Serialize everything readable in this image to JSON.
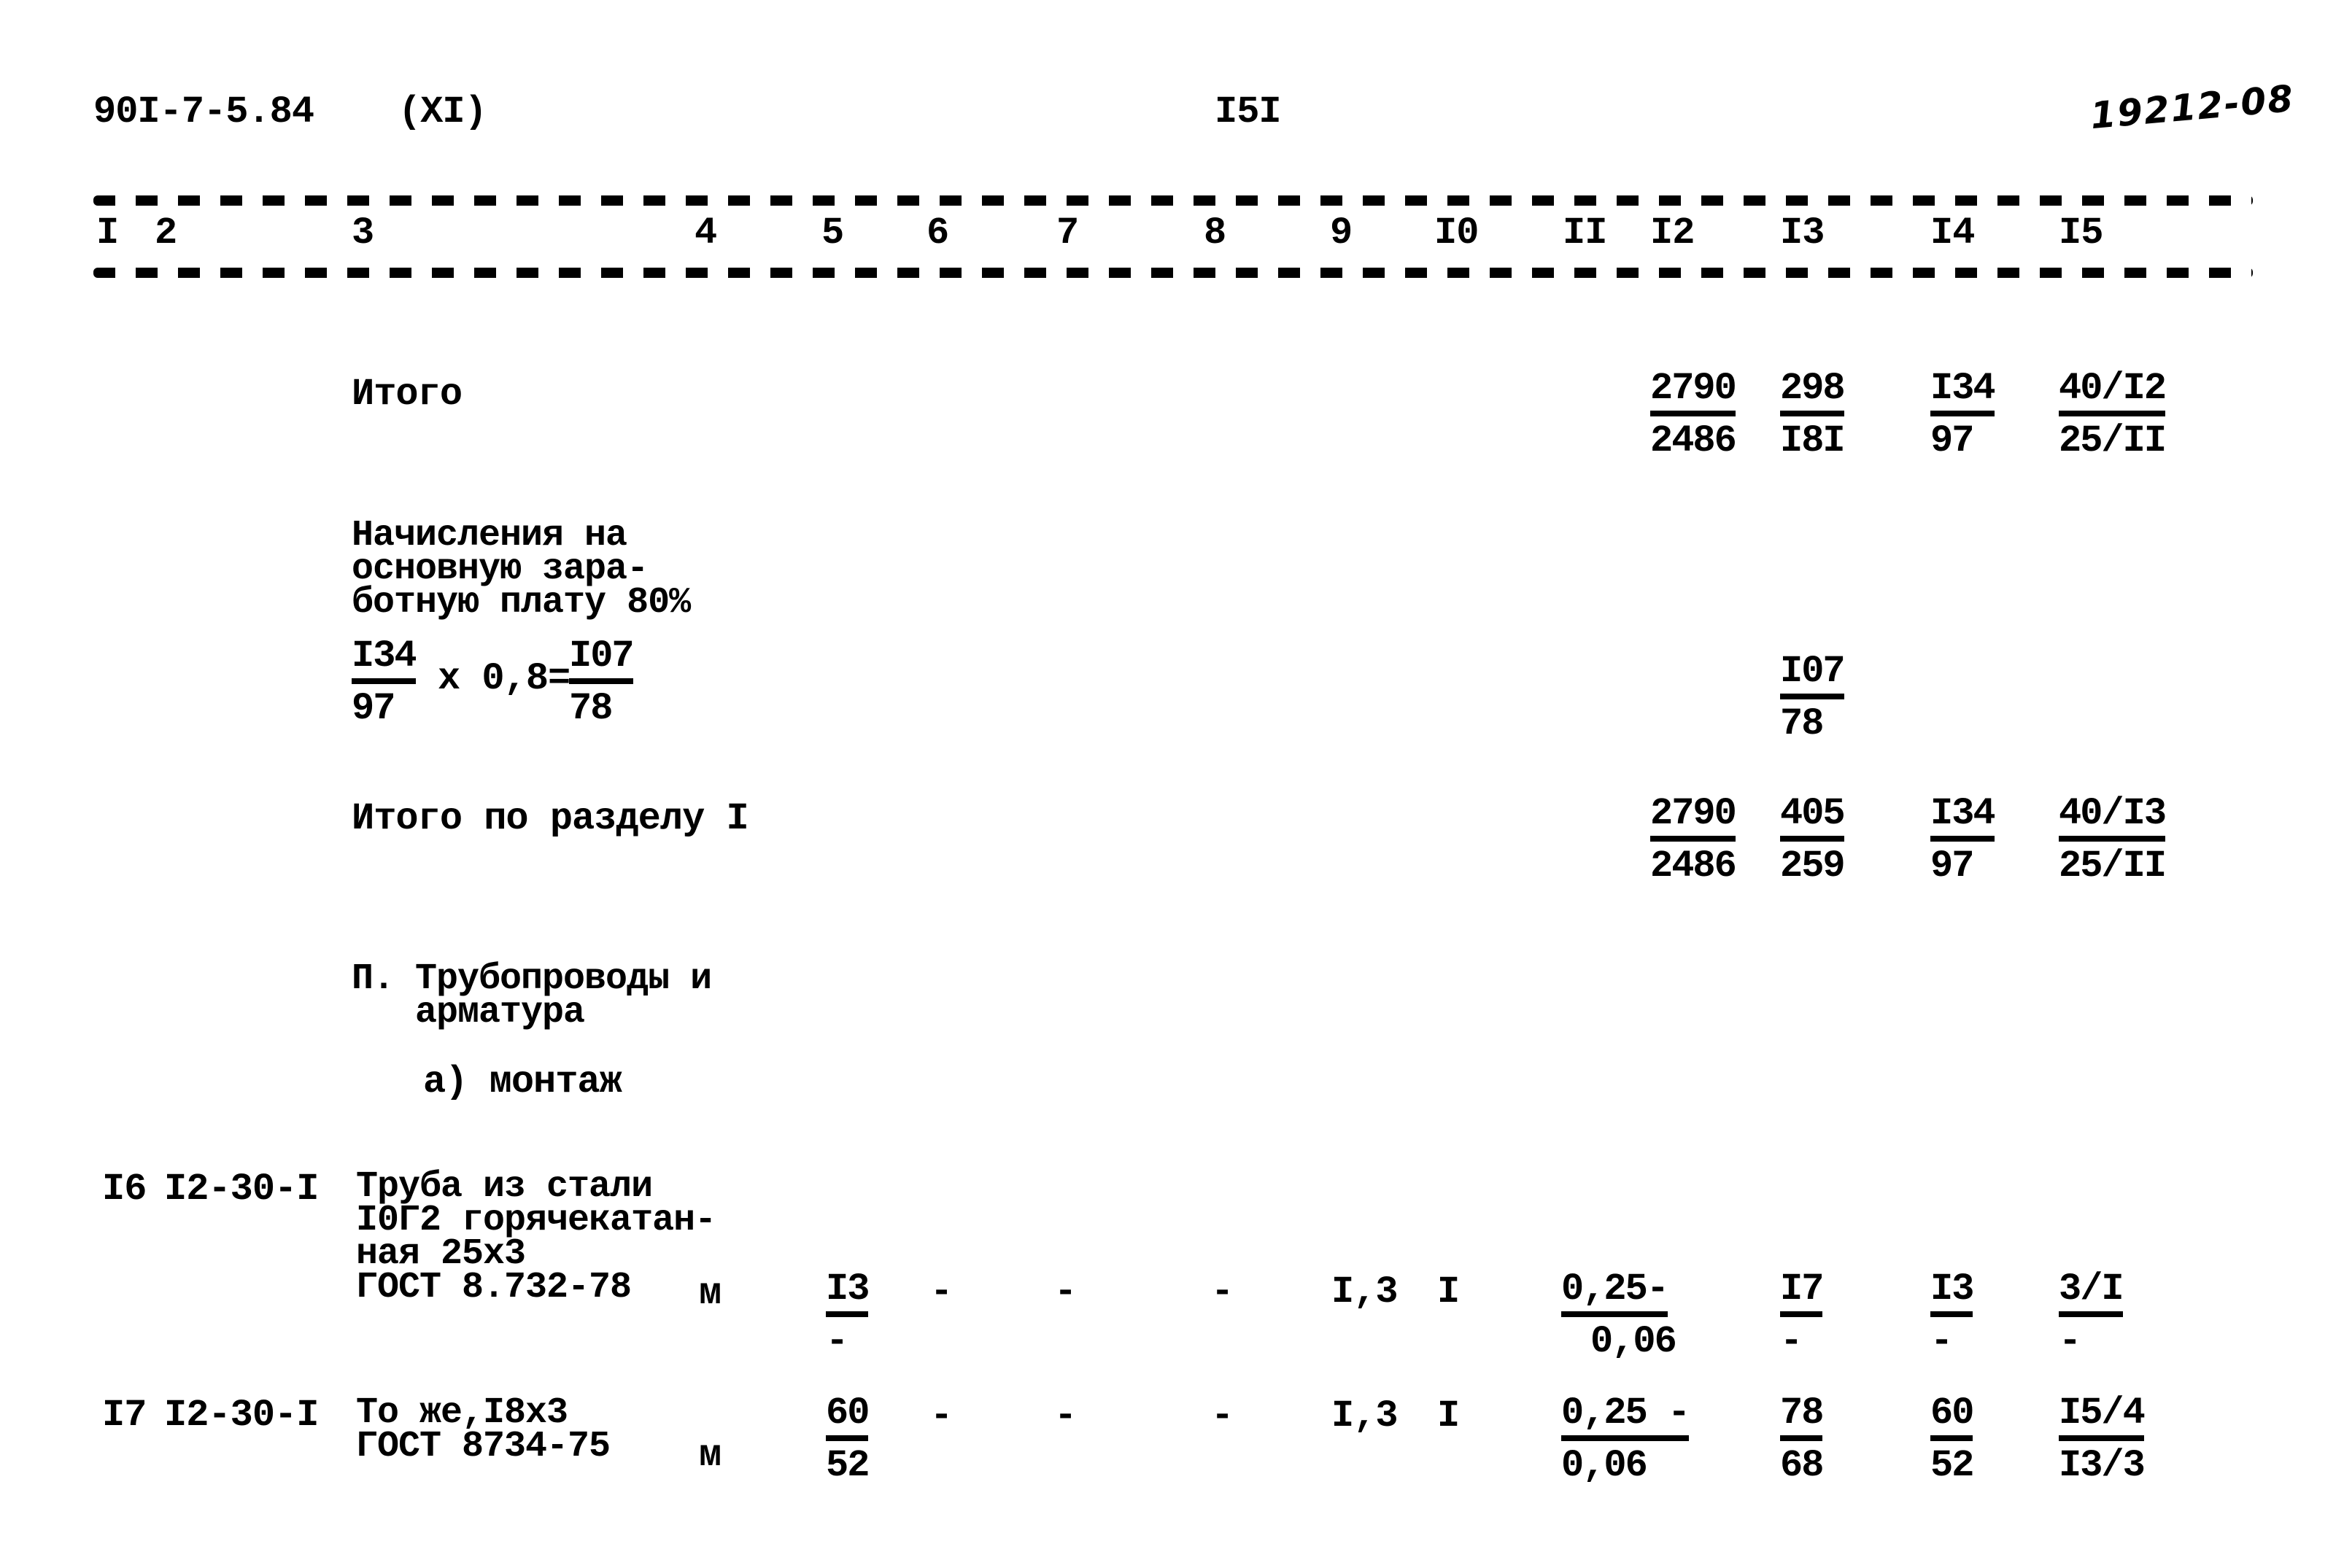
{
  "header": {
    "doc_code": "90I-7-5.84",
    "part": "(XI)",
    "page_number": "I5I",
    "handwritten_ref": "19212-08"
  },
  "columns": [
    "I",
    "2",
    "3",
    "4",
    "5",
    "6",
    "7",
    "8",
    "9",
    "I0",
    "II",
    "I2",
    "I3",
    "I4",
    "I5"
  ],
  "rows": {
    "itogo": {
      "label": "Итого",
      "c12": {
        "num": "2790",
        "den": "2486"
      },
      "c13": {
        "num": "298",
        "den": "I8I"
      },
      "c14": {
        "num": "I34",
        "den": "97"
      },
      "c15": {
        "num": "40/I2",
        "den": "25/II"
      }
    },
    "nachisleniya": {
      "label_lines": [
        "Начисления на",
        "основную зара-",
        "ботную плату 80%"
      ],
      "formula": {
        "left": {
          "num": "I34",
          "den": "97"
        },
        "operator": "x 0,8=",
        "right": {
          "num": "I07",
          "den": "78"
        }
      },
      "c13": {
        "num": "I07",
        "den": "78"
      }
    },
    "itogo_razdel": {
      "label": "Итого по разделу I",
      "c12": {
        "num": "2790",
        "den": "2486"
      },
      "c13": {
        "num": "405",
        "den": "259"
      },
      "c14": {
        "num": "I34",
        "den": "97"
      },
      "c15": {
        "num": "40/I3",
        "den": "25/II"
      }
    },
    "section2": {
      "title_lines": [
        "П. Трубопроводы и",
        "   арматура"
      ],
      "subtitle": "а) монтаж"
    },
    "item16": {
      "no": "I6",
      "code": "I2-30-I",
      "desc_lines": [
        "Труба из стали",
        "I0Г2 горячекатан-",
        "ная 25x3",
        "ГОСТ 8.732-78"
      ],
      "unit": "м",
      "c5": {
        "num": "I3",
        "den": "-"
      },
      "c6": "-",
      "c7": "-",
      "c8": "-",
      "c9": "I,3",
      "c10": "I",
      "c11": {
        "num": "0,25-",
        "den": "0,06"
      },
      "c13": {
        "num": "I7",
        "den": "-"
      },
      "c14": {
        "num": "I3",
        "den": "-"
      },
      "c15": {
        "num": "3/I",
        "den": "-"
      }
    },
    "item17": {
      "no": "I7",
      "code": "I2-30-I",
      "desc_lines": [
        "То же,I8x3",
        "ГОСТ 8734-75"
      ],
      "unit": "м",
      "c5": {
        "num": "60",
        "den": "52"
      },
      "c6": "-",
      "c7": "-",
      "c8": "-",
      "c9": "I,3",
      "c10": "I",
      "c11": {
        "num": "0,25 -",
        "den": "0,06"
      },
      "c13": {
        "num": "78",
        "den": "68"
      },
      "c14": {
        "num": "60",
        "den": "52"
      },
      "c15": {
        "num": "I5/4",
        "den": "I3/3"
      }
    }
  }
}
